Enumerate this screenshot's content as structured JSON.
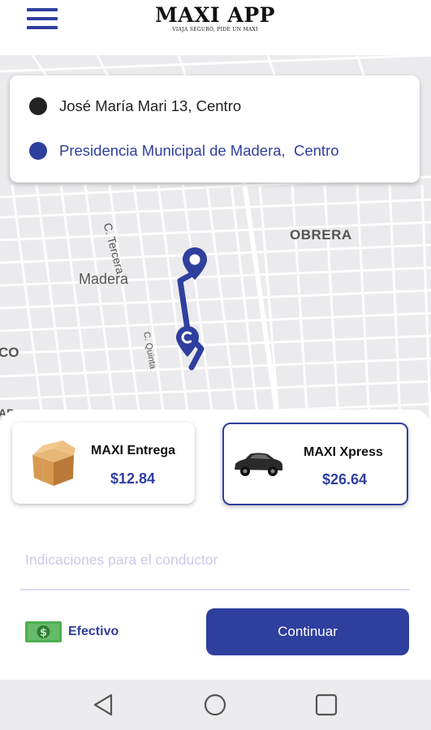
{
  "header": {
    "menu_icon": "hamburger-menu-icon",
    "title": "MAXI APP",
    "tagline": "VIAJA SEGURO, PIDE UN MAXI"
  },
  "route": {
    "origin": "José María Mari 13, Centro",
    "destination": "Presidencia Municipal de Madera,  Centro"
  },
  "map": {
    "labels": {
      "street_tercera": "C. Tercera",
      "street_quinta": "C. Quinta",
      "town": "Madera",
      "neighborhood": "OBRERA",
      "edge_left": "CO",
      "edge_bottom": "AP"
    },
    "route_color": "#2f3f9e"
  },
  "services": [
    {
      "name": "MAXI Entrega",
      "price": "$12.84",
      "icon": "box-icon",
      "selected": false
    },
    {
      "name": "MAXI Xpress",
      "price": "$26.64",
      "icon": "car-icon",
      "selected": true
    }
  ],
  "form": {
    "instructions_placeholder": "Indicaciones para el conductor",
    "payment_label": "Efectivo",
    "payment_icon": "cash-icon",
    "continue_label": "Continuar"
  },
  "navbar": {
    "icons": [
      "back-icon",
      "home-icon",
      "recents-icon"
    ]
  },
  "colors": {
    "accent": "#2f3f9e",
    "origin_dot": "#222222",
    "map_background": "#ebebed"
  }
}
